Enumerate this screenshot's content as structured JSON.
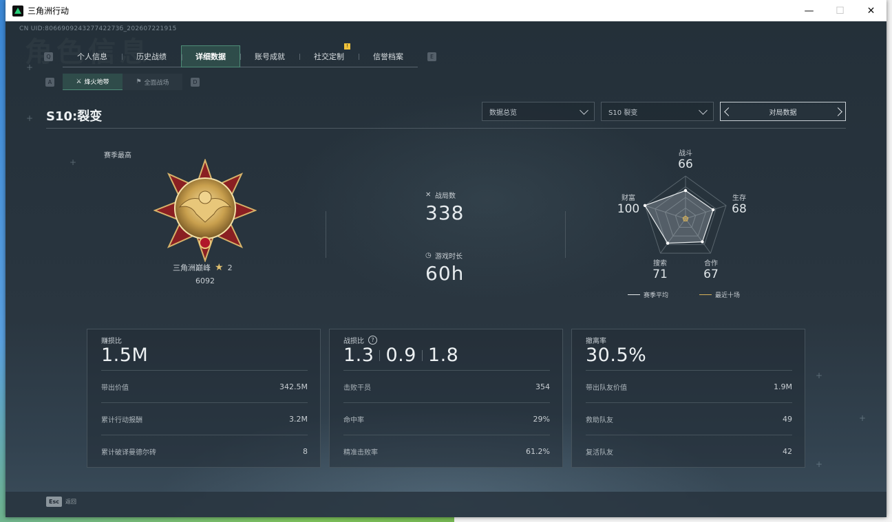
{
  "window": {
    "title": "三角洲行动",
    "minimize": "—",
    "maximize": "☐",
    "close": "✕"
  },
  "uid": "CN UID:806690924327742273б_202607221915",
  "bg_text": "角色信息",
  "nav": {
    "left_key": "Q",
    "right_key": "E",
    "tabs": [
      {
        "label": "个人信息"
      },
      {
        "label": "历史战绩"
      },
      {
        "label": "详细数据",
        "active": true
      },
      {
        "label": "账号成就"
      },
      {
        "label": "社交定制",
        "badge": "!"
      },
      {
        "label": "信誉档案"
      }
    ]
  },
  "subnav": {
    "left_key": "A",
    "right_key": "D",
    "tabs": [
      {
        "label": "烽火地带",
        "icon": "outpost-icon",
        "active": true
      },
      {
        "label": "全面战场",
        "icon": "battlefield-icon"
      }
    ]
  },
  "season_title": "S10:裂变",
  "filters": {
    "view": "数据总览",
    "season": "S10 裂变",
    "pager_label": "对局数据"
  },
  "best": {
    "label": "赛季最高",
    "rank_name": "三角洲巅峰",
    "stars": "2",
    "score": "6092"
  },
  "center_stats": [
    {
      "label": "战局数",
      "value": "338",
      "icon": "crossed-swords-icon"
    },
    {
      "label": "游戏时长",
      "value": "60h",
      "icon": "clock-icon"
    }
  ],
  "radar": {
    "axes": [
      {
        "name": "战斗",
        "value": "66",
        "score": 66
      },
      {
        "name": "生存",
        "value": "68",
        "score": 68
      },
      {
        "name": "合作",
        "value": "67",
        "score": 67
      },
      {
        "name": "搜索",
        "value": "71",
        "score": 71
      },
      {
        "name": "财富",
        "value": "100",
        "score": 100
      }
    ],
    "legend": [
      {
        "label": "赛季平均",
        "color": "#e6eaec"
      },
      {
        "label": "最近十场",
        "color": "#d8b25a"
      }
    ]
  },
  "cards": [
    {
      "label": "赚损比",
      "values": [
        "1.5M"
      ],
      "rows": [
        {
          "label": "带出价值",
          "value": "342.5M"
        },
        {
          "label": "累计行动报酬",
          "value": "3.2M"
        },
        {
          "label": "累计破译曼德尔砖",
          "value": "8"
        }
      ]
    },
    {
      "label": "战损比",
      "help": "?",
      "values": [
        "1.3",
        "0.9",
        "1.8"
      ],
      "rows": [
        {
          "label": "击败干员",
          "value": "354"
        },
        {
          "label": "命中率",
          "value": "29%"
        },
        {
          "label": "精准击败率",
          "value": "61.2%"
        }
      ]
    },
    {
      "label": "撤离率",
      "values": [
        "30.5%"
      ],
      "rows": [
        {
          "label": "带出队友价值",
          "value": "1.9M"
        },
        {
          "label": "救助队友",
          "value": "49"
        },
        {
          "label": "复活队友",
          "value": "42"
        }
      ]
    }
  ],
  "footer": {
    "key": "Esc",
    "label": "返回"
  },
  "colors": {
    "accent": "#4f8d78",
    "badge": "#f0c23a",
    "gold": "#d8b25a"
  }
}
